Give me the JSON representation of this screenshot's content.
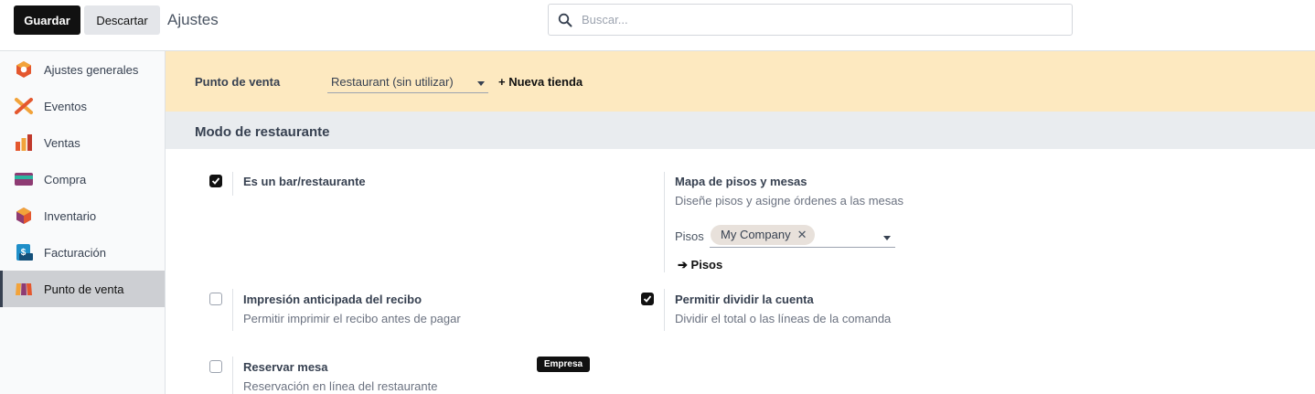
{
  "toolbar": {
    "save_label": "Guardar",
    "discard_label": "Descartar",
    "title": "Ajustes"
  },
  "search": {
    "placeholder": "Buscar..."
  },
  "sidebar": {
    "items": [
      {
        "label": "Ajustes generales",
        "icon": "settings-app-icon"
      },
      {
        "label": "Eventos",
        "icon": "events-app-icon"
      },
      {
        "label": "Ventas",
        "icon": "sales-app-icon"
      },
      {
        "label": "Compra",
        "icon": "purchase-app-icon"
      },
      {
        "label": "Inventario",
        "icon": "inventory-app-icon"
      },
      {
        "label": "Facturación",
        "icon": "invoicing-app-icon"
      },
      {
        "label": "Punto de venta",
        "icon": "pos-app-icon",
        "active": true
      }
    ]
  },
  "banner": {
    "label": "Punto de venta",
    "store_value": "Restaurant (sin utilizar)",
    "new_store": "+ Nueva tienda"
  },
  "section": {
    "title": "Modo de restaurante",
    "settings": [
      {
        "title": "Es un bar/restaurante",
        "checked": true
      },
      {
        "title": "Mapa de pisos y mesas",
        "description": "Diseñe pisos y asigne órdenes a las mesas",
        "floors_label": "Pisos",
        "floors_tag": "My Company",
        "floors_remove": "✕",
        "floors_link": "Pisos",
        "floors_link_arrow": "➔"
      },
      {
        "title": "Impresión anticipada del recibo",
        "description": "Permitir imprimir el recibo antes de pagar",
        "checked": false
      },
      {
        "title": "Permitir dividir la cuenta",
        "description": "Dividir el total o las líneas de la comanda",
        "checked": true
      },
      {
        "title": "Reservar mesa",
        "description": "Reservación en línea del restaurante",
        "checked": false,
        "badge": "Empresa"
      }
    ]
  },
  "colors": {
    "banner": "#fde9c0",
    "section_header": "#e9ecef",
    "primary": "#111111"
  }
}
